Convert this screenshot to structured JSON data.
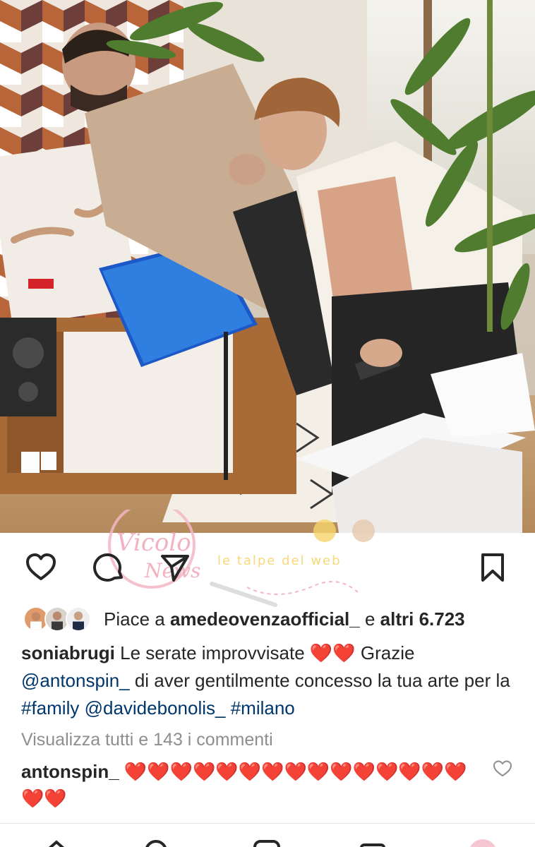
{
  "post": {
    "likes": {
      "prefix": "Piace a ",
      "user": "amedeovenzaofficial_",
      "middle": " e ",
      "others": "altri 6.723"
    },
    "caption": {
      "user": "soniabrugi",
      "text_1": " Le serate improvvisate ",
      "hearts_1": "❤️❤️",
      "text_2": " Grazie ",
      "mention_1": "@antonspin_",
      "text_3": "  di aver gentilmente concesso la tua arte per la ",
      "hashtag_1": "#family",
      "text_4": " ",
      "mention_2": "@davidebonolis_",
      "text_5": "  ",
      "hashtag_2": "#milano"
    },
    "view_comments": "Visualizza tutti e 143 i commenti",
    "comment": {
      "user": "antonspin_",
      "hearts": "❤️❤️❤️❤️❤️❤️❤️❤️❤️❤️❤️❤️❤️❤️❤️❤️❤️"
    }
  },
  "watermark": {
    "logo_text": "Vicolo delle News",
    "tagline": "le talpe del web"
  },
  "icons": {
    "like": "heart-outline-icon",
    "comment": "comment-bubble-icon",
    "share": "paper-plane-icon",
    "save": "bookmark-icon",
    "comment_like": "small-heart-icon"
  },
  "colors": {
    "text": "#262626",
    "link": "#00376b",
    "muted": "#8e8e8e",
    "heart": "#e0161d"
  }
}
